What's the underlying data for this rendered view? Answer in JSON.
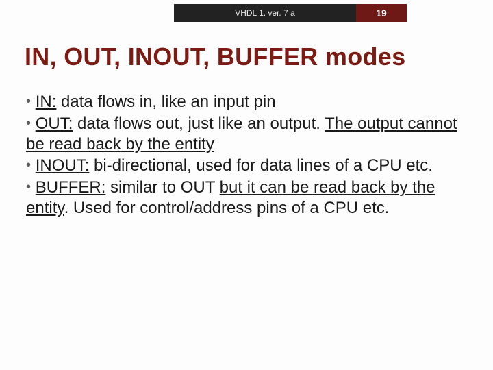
{
  "header": {
    "label": "VHDL 1. ver. 7 a",
    "page_number": "19"
  },
  "title": "IN, OUT, INOUT, BUFFER modes",
  "bullets": {
    "b1_term": "IN:",
    "b1_rest": " data flows in, like an input pin",
    "b2_term": "OUT:",
    "b2_mid": " data flows out, just like an output. ",
    "b2_u": "The output cannot be read back by the entity",
    "b3_term": "INOUT:",
    "b3_rest": " bi-directional, used for data lines of a CPU etc.",
    "b4_term": "BUFFER:",
    "b4_mid": " similar to OUT ",
    "b4_u": "but it can be read back by the entity",
    "b4_rest": ". Used for control/address pins of a CPU etc."
  }
}
